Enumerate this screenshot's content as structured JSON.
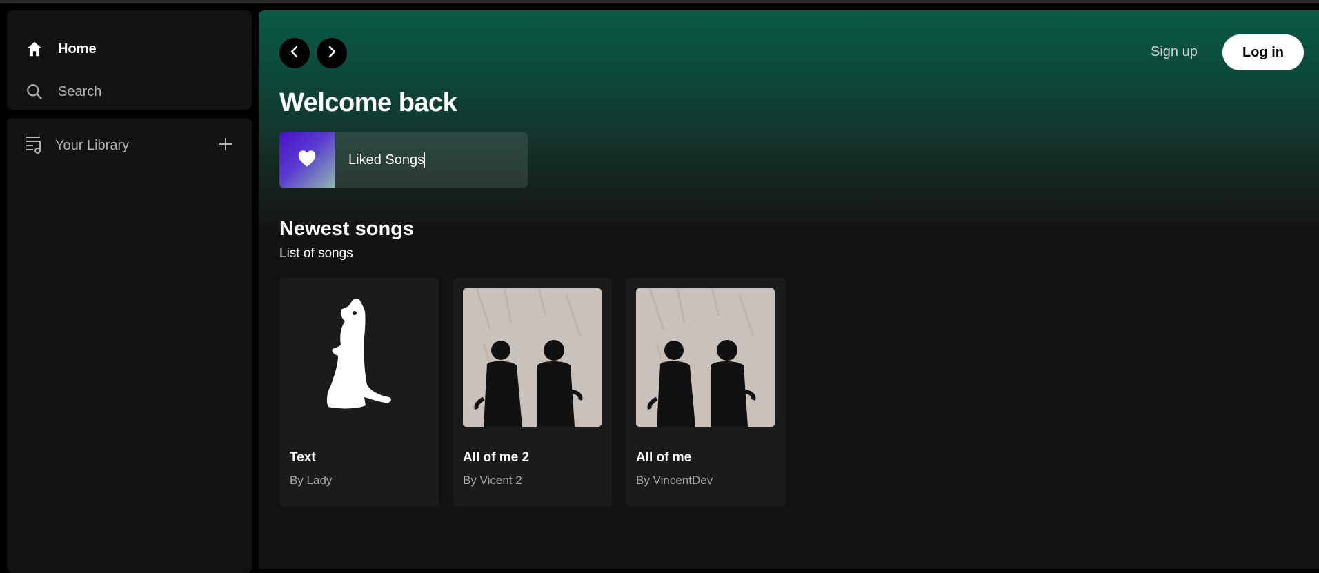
{
  "sidebar": {
    "nav": [
      {
        "label": "Home",
        "icon": "home-icon"
      },
      {
        "label": "Search",
        "icon": "search-icon"
      }
    ],
    "library": {
      "label": "Your Library",
      "icon": "library-icon",
      "add_icon": "plus-icon"
    }
  },
  "header": {
    "back_icon": "chevron-left-icon",
    "forward_icon": "chevron-right-icon",
    "signup_label": "Sign up",
    "login_label": "Log in"
  },
  "main": {
    "welcome": "Welcome back",
    "liked_songs": {
      "label": "Liked Songs",
      "icon": "heart-icon"
    },
    "section": {
      "title": "Newest songs",
      "subtitle": "List of songs"
    },
    "songs": [
      {
        "title": "Text",
        "artist": "By Lady",
        "art": "kangaroo-silhouette"
      },
      {
        "title": "All of me 2",
        "artist": "By Vicent 2",
        "art": "two-men-photo"
      },
      {
        "title": "All of me",
        "artist": "By VincentDev",
        "art": "two-men-photo"
      }
    ]
  },
  "colors": {
    "gradient_top": "#0a5a45",
    "background": "#121212",
    "card": "#1b1b1b",
    "muted_text": "#a7a7a7",
    "liked_gradient_start": "#4a12c8"
  }
}
